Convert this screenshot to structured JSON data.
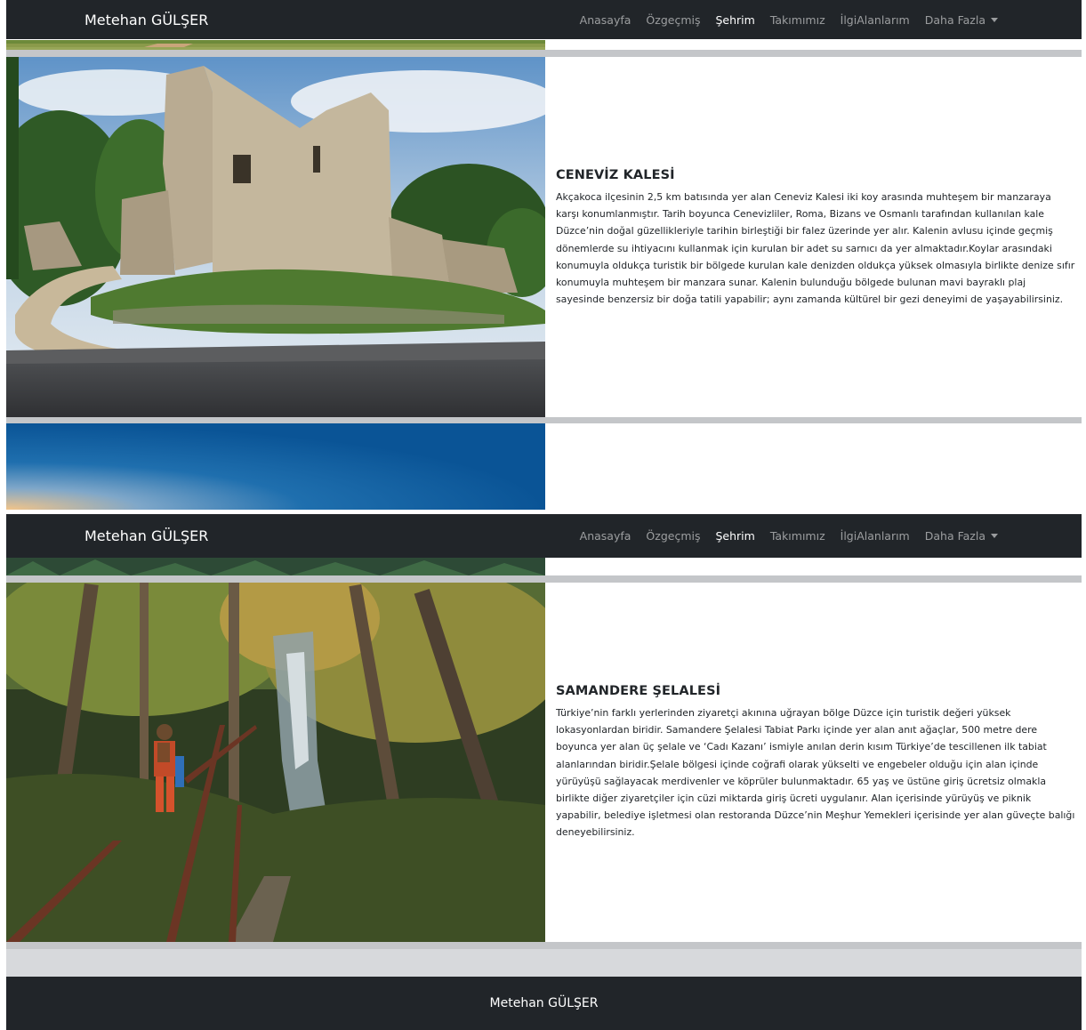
{
  "navbar": {
    "brand": "Metehan GÜLŞER",
    "links": [
      {
        "label": "Anasayfa"
      },
      {
        "label": "Özgeçmiş"
      },
      {
        "label": "Şehrim"
      },
      {
        "label": "Takımımız"
      },
      {
        "label": "İlgiAlanlarım"
      },
      {
        "label": "Daha Fazla"
      }
    ]
  },
  "cards": [
    {
      "title": "CENEVİZ KALESİ",
      "image_icon": "castle-photo",
      "text": "Akçakoca ilçesinin 2,5 km batısında yer alan Ceneviz Kalesi iki koy arasında muhteşem bir manzaraya karşı konumlanmıştır. Tarih boyunca Cenevizliler, Roma, Bizans ve Osmanlı tarafından kullanılan kale Düzce’nin doğal güzellikleriyle tarihin birleştiği bir falez üzerinde yer alır. Kalenin avlusu içinde geçmiş dönemlerde su ihtiyacını kullanmak için kurulan bir adet su sarnıcı da yer almaktadır.Koylar arasındaki konumuyla oldukça turistik bir bölgede kurulan kale denizden oldukça yüksek olmasıyla birlikte denize sıfır konumuyla muhteşem bir manzara sunar. Kalenin bulunduğu bölgede bulunan mavi bayraklı plaj sayesinde benzersiz bir doğa tatili yapabilir; aynı zamanda kültürel bir gezi deneyimi de yaşayabilirsiniz."
    },
    {
      "title": "SAMANDERE ŞELALESİ",
      "image_icon": "forest-waterfall-photo",
      "text": "Türkiye’nin farklı yerlerinden ziyaretçi akınına uğrayan bölge Düzce için turistik değeri yüksek lokasyonlardan biridir. Samandere Şelalesi Tabiat Parkı içinde yer alan anıt ağaçlar, 500 metre dere boyunca yer alan üç şelale ve ‘Cadı Kazanı’ ismiyle anılan derin kısım Türkiye’de tescillenen ilk tabiat alanlarından biridir.Şelale bölgesi içinde coğrafi olarak yükselti ve engebeler olduğu için alan içinde yürüyüşü sağlayacak merdivenler ve köprüler bulunmaktadır. 65 yaş ve üstüne giriş ücretsiz olmakla birlikte diğer ziyaretçiler için cüzi miktarda giriş ücreti uygulanır. Alan içerisinde yürüyüş ve piknik yapabilir, belediye işletmesi olan restoranda Düzce’nin Meşhur Yemekleri içerisinde yer alan güveçte balığı deneyebilirsiniz."
    }
  ],
  "footer": {
    "text": "Metehan GÜLŞER"
  },
  "colors": {
    "navbar_bg": "#212529",
    "separator": "#c4c6c9",
    "page_bg": "#d7d9dc"
  }
}
